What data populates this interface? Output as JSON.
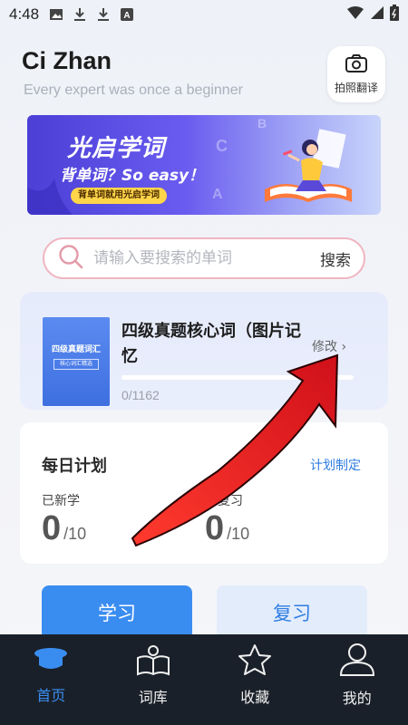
{
  "status_bar": {
    "time": "4:48"
  },
  "header": {
    "title": "Ci Zhan",
    "subtitle": "Every expert was once a beginner",
    "photo_translate_label": "拍照翻译"
  },
  "banner": {
    "title": "光启学词",
    "subtitle": "背单词？So easy！",
    "pill": "背单词就用光启学词"
  },
  "search": {
    "placeholder": "请输入要搜索的单词",
    "button_label": "搜索"
  },
  "book": {
    "title": "四级真题核心词（图片记忆",
    "edit_label": "修改 ›",
    "progress": "0/1162",
    "progress_fraction": 0,
    "cover_title": "四级真题词汇",
    "cover_sub": "核心词汇精选"
  },
  "plan": {
    "title": "每日计划",
    "link_label": "计划制定",
    "new_label": "已新学",
    "new_value": "0",
    "new_total": "/10",
    "review_label": "已复习",
    "review_value": "0",
    "review_total": "/10"
  },
  "actions": {
    "learn": "学习",
    "review": "复习"
  },
  "nav": {
    "items": [
      {
        "label": "首页",
        "icon": "graduation-cap-icon",
        "active": true
      },
      {
        "label": "词库",
        "icon": "open-book-icon",
        "active": false
      },
      {
        "label": "收藏",
        "icon": "star-icon",
        "active": false
      },
      {
        "label": "我的",
        "icon": "user-icon",
        "active": false
      }
    ]
  },
  "colors": {
    "accent": "#3a8df0",
    "nav_bg": "#1a2029",
    "arrow": "#e0201e"
  }
}
